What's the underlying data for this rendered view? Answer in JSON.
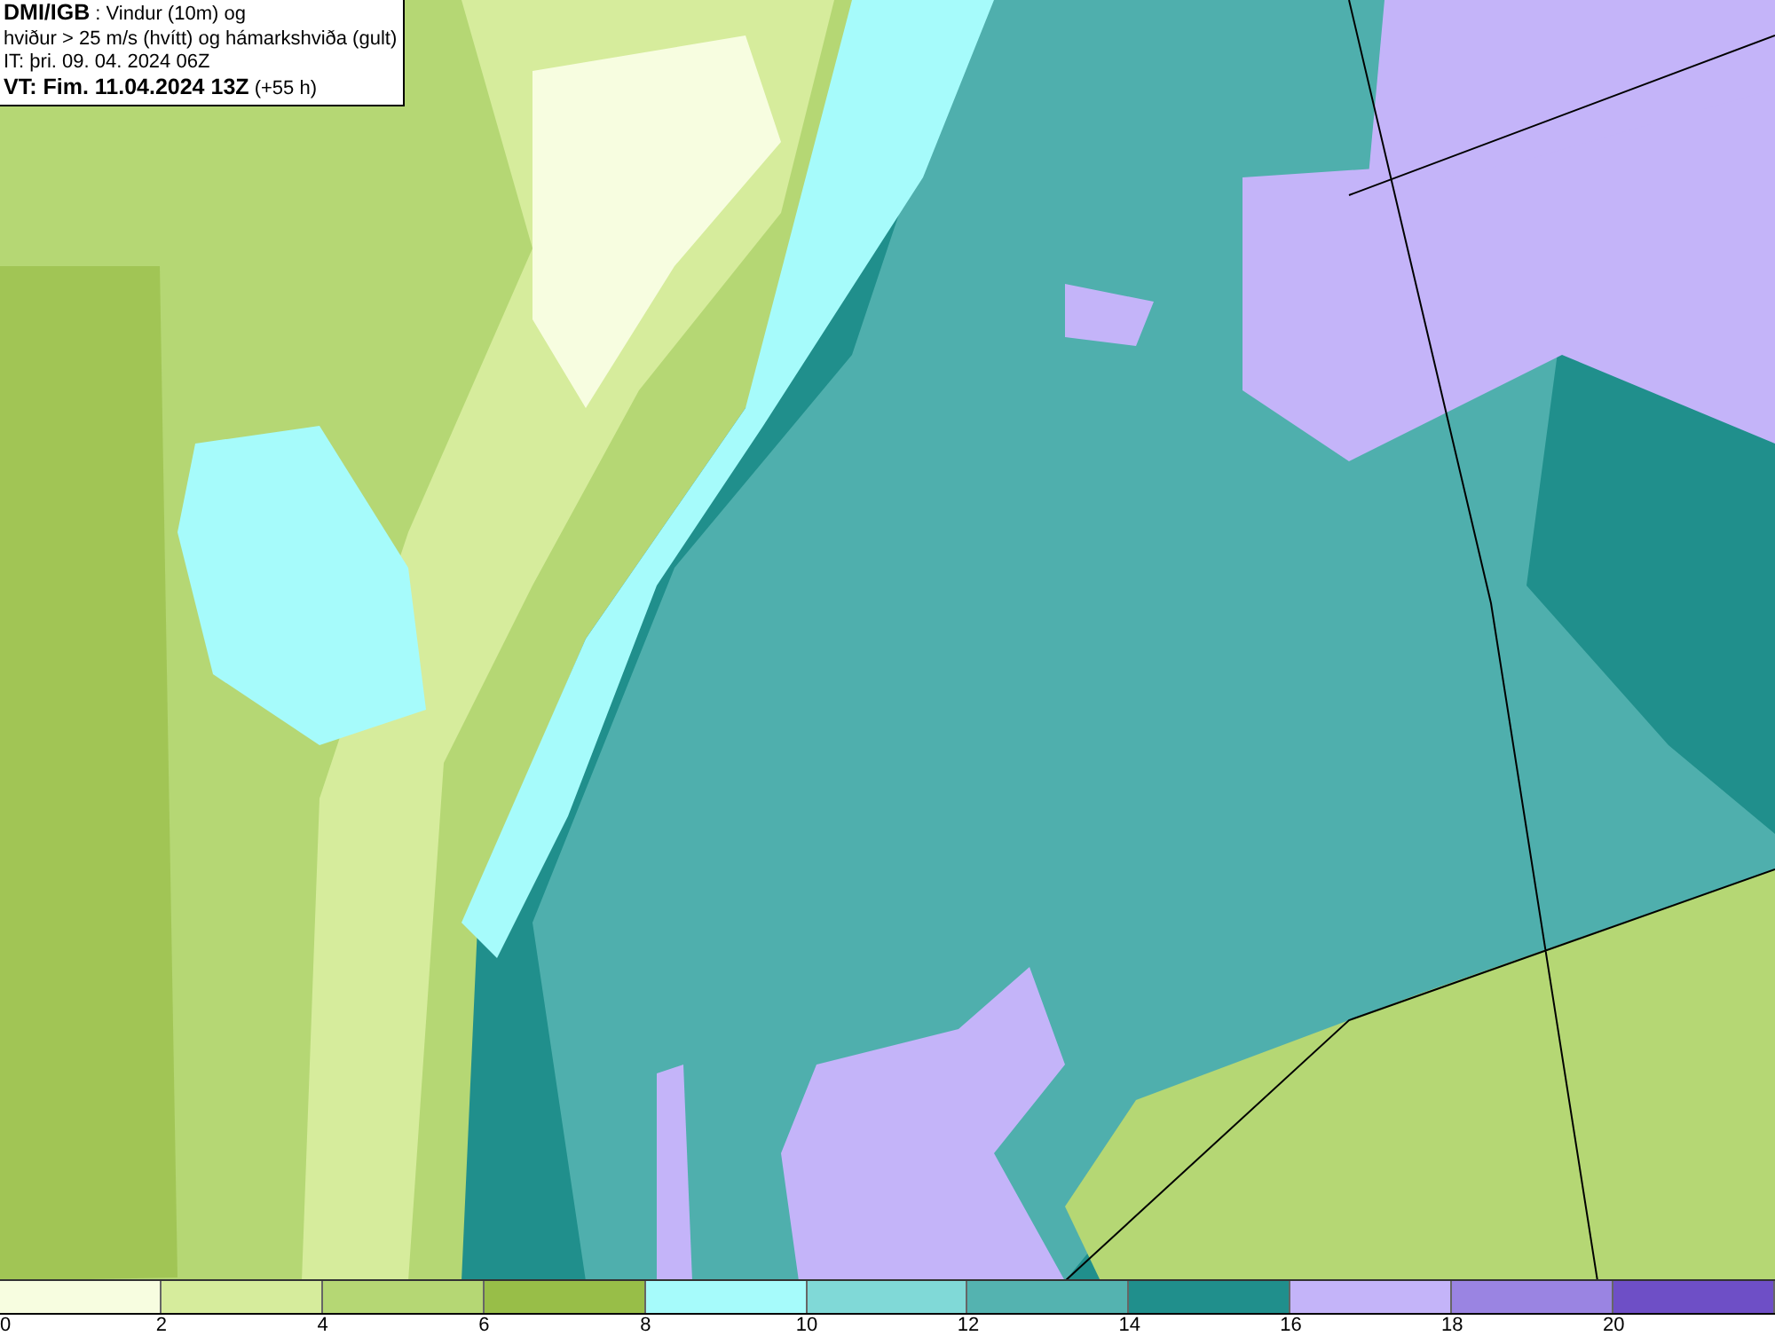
{
  "title_box": {
    "lines": [
      "**DMI/IGB** : Vindur (10m) og",
      "hviður > 25 m/s (hvítt) og hámarkshviða (gult)",
      "IT: þri. 09. 04. 2024 06Z",
      "**VT: Fim. 11.04.2024 13Z** (+55 h)"
    ]
  },
  "legend": {
    "bins": [
      {
        "color": "#f7fde0"
      },
      {
        "color": "#d6ec9c"
      },
      {
        "color": "#b5d774"
      },
      {
        "color": "#98be48"
      },
      {
        "color": "#a6fbfb"
      },
      {
        "color": "#80d9d7"
      },
      {
        "color": "#54b3b0"
      },
      {
        "color": "#208f8c"
      },
      {
        "color": "#c4b4f9"
      },
      {
        "color": "#9a84e2"
      },
      {
        "color": "#6e4fc6"
      }
    ],
    "ticks": [
      "0",
      "2",
      "4",
      "6",
      "8",
      "10",
      "12",
      "14",
      "16",
      "18",
      "20"
    ]
  }
}
